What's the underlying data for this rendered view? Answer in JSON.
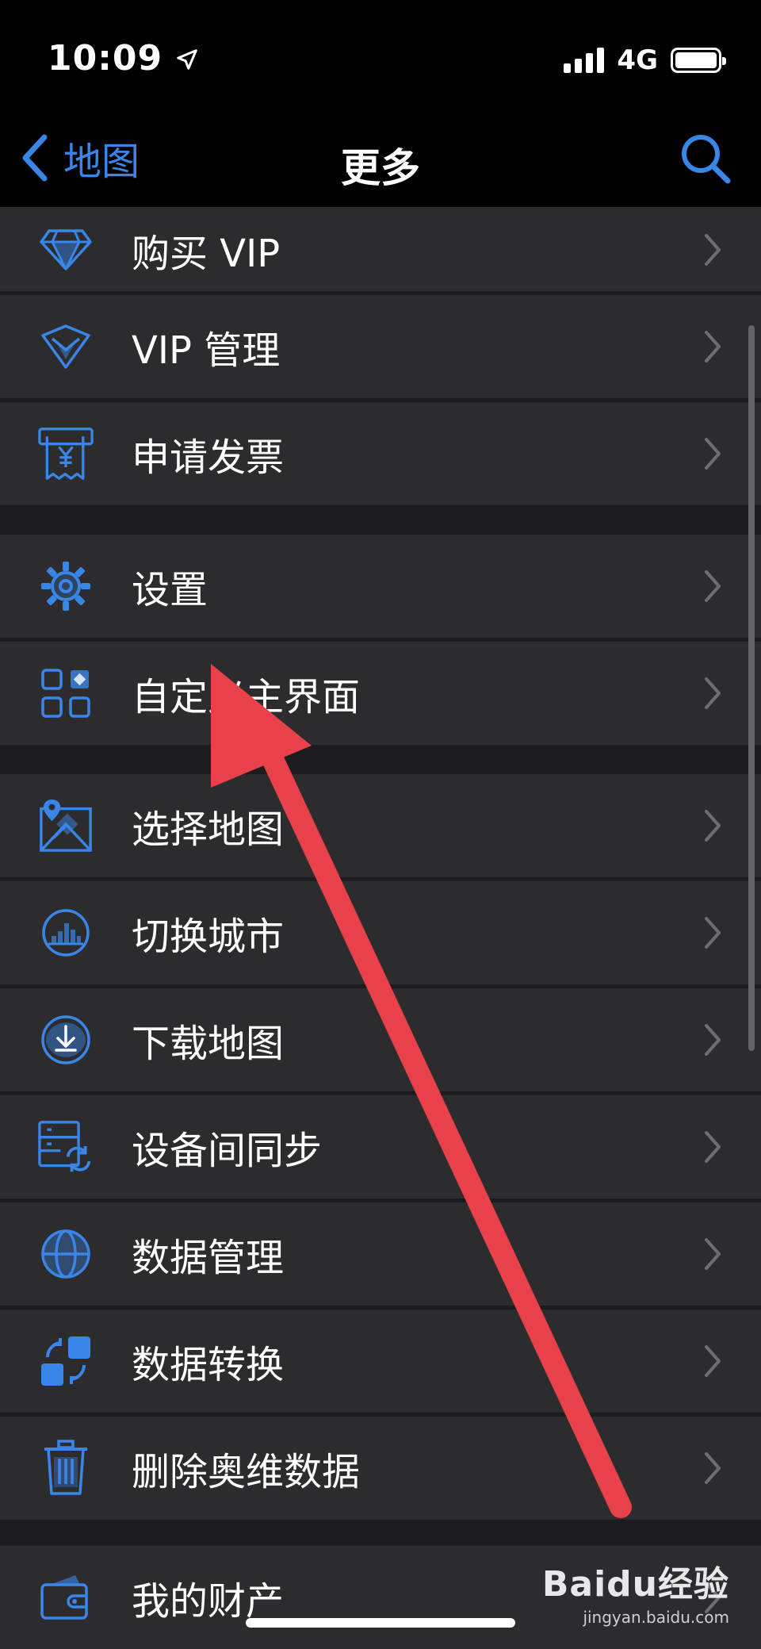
{
  "status_bar": {
    "time": "10:09",
    "network": "4G"
  },
  "nav": {
    "back_label": "地图",
    "title": "更多"
  },
  "menu": {
    "group1": [
      {
        "label": "购买 VIP",
        "icon": "diamond-icon"
      },
      {
        "label": "VIP 管理",
        "icon": "vip-badge-icon"
      },
      {
        "label": "申请发票",
        "icon": "invoice-icon"
      }
    ],
    "group2": [
      {
        "label": "设置",
        "icon": "gear-icon"
      },
      {
        "label": "自定义主界面",
        "icon": "grid-icon"
      }
    ],
    "group3": [
      {
        "label": "选择地图",
        "icon": "map-pin-icon"
      },
      {
        "label": "切换城市",
        "icon": "city-icon"
      },
      {
        "label": "下载地图",
        "icon": "download-icon"
      },
      {
        "label": "设备间同步",
        "icon": "sync-icon"
      },
      {
        "label": "数据管理",
        "icon": "globe-icon"
      },
      {
        "label": "数据转换",
        "icon": "convert-icon"
      },
      {
        "label": "删除奥维数据",
        "icon": "trash-icon"
      }
    ],
    "group4": [
      {
        "label": "我的财产",
        "icon": "wallet-icon"
      }
    ]
  },
  "watermark": {
    "brand": "Baidu经验",
    "url": "jingyan.baidu.com"
  },
  "colors": {
    "accent": "#3a86e8",
    "arrow": "#e8414a",
    "row_bg": "#2c2c2e",
    "background": "#1c1c1e"
  }
}
